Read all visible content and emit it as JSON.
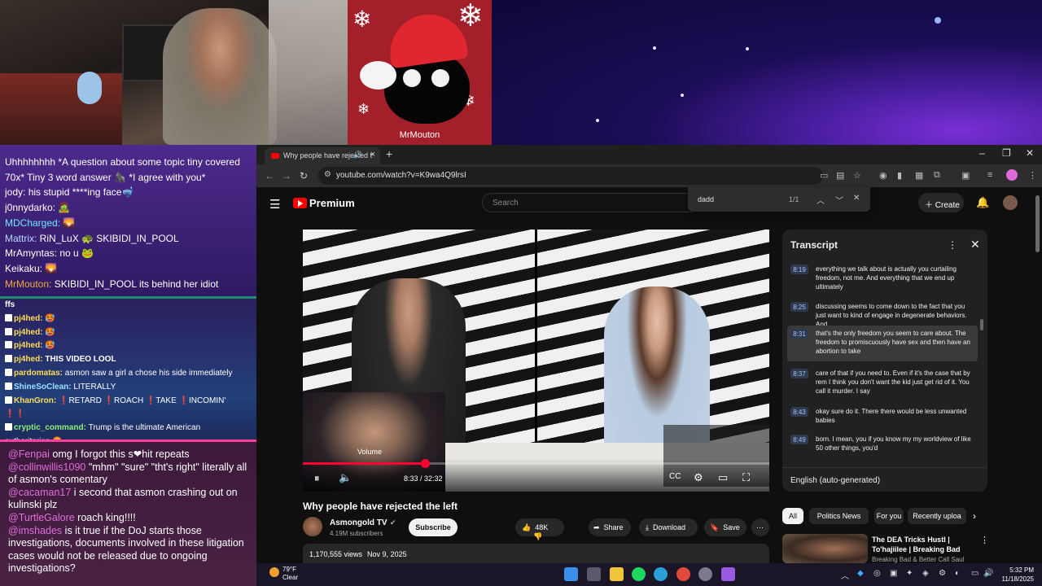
{
  "overlay": {
    "mascot_name": "MrMouton"
  },
  "chat_top": [
    {
      "user": "",
      "user_color": "#ffffff",
      "text": "Uhhhhhhhh *A question about some topic tiny covered"
    },
    {
      "user": "",
      "user_color": "#ffffff",
      "text": "70x* Tiny 3 word answer 🦍 *I agree with you*"
    },
    {
      "user": "jody:",
      "user_color": "#ffffff",
      "text": "his stupid ****ing face🤿"
    },
    {
      "user": "j0nnydarko:",
      "user_color": "#ffffff",
      "text": "🧟"
    },
    {
      "user": "MDCharged:",
      "user_color": "#6fe6ff",
      "text": "🌄"
    },
    {
      "user": "Mattrix:",
      "user_color": "#b9d8ff",
      "text": "RiN_LuX 🐢 SKIBIDI_IN_POOL"
    },
    {
      "user": "MrAmyntas:",
      "user_color": "#ffffff",
      "text": "no u 🐸"
    },
    {
      "user": "Keikaku:",
      "user_color": "#ffffff",
      "text": "🌄"
    },
    {
      "user": "MrMouton:",
      "user_color": "#f3a93a",
      "text": "SKIBIDI_IN_POOL its behind her idiot"
    }
  ],
  "chat_mid": [
    {
      "user": "ffs",
      "user_color": "#ffffff",
      "text": ""
    },
    {
      "user": "pj4hed:",
      "user_color": "#ffdd55",
      "text": "🥵"
    },
    {
      "user": "pj4hed:",
      "user_color": "#ffdd55",
      "text": "🥵"
    },
    {
      "user": "pj4hed:",
      "user_color": "#ffdd55",
      "text": "🥵"
    },
    {
      "user": "pj4hed:",
      "user_color": "#ffdd55",
      "text": "THIS VIDEO LOOL"
    },
    {
      "user": "pardomatas:",
      "user_color": "#ffdd55",
      "text": "asmon saw a girl a chose his side immediately"
    },
    {
      "user": "ShineSoClean:",
      "user_color": "#9ae0ff",
      "text": "LITERALLY"
    },
    {
      "user": "KhanGron:",
      "user_color": "#ffdd55",
      "text": "❗RETARD ❗ROACH ❗TAKE ❗INCOMIN'"
    },
    {
      "user": "",
      "user_color": "#ffffff",
      "text": "❗❗"
    },
    {
      "user": "cryptic_command:",
      "user_color": "#8af07a",
      "text": "Trump is the ultimate American"
    },
    {
      "user": "",
      "user_color": "#ffffff",
      "text": "authoritarian 😡"
    }
  ],
  "chat_bottom": [
    {
      "user": "@Fenpai",
      "text": "omg I forgot this s❤hit repeats"
    },
    {
      "user": "@collinwillis1090",
      "text": "\"mhm\" \"sure\" \"tht's right\" literally all of asmon's comentary"
    },
    {
      "user": "@cacaman17",
      "text": "i second that asmon crashing out on kulinski plz"
    },
    {
      "user": "@TurtleGalore",
      "text": "roach king!!!!"
    },
    {
      "user": "@imshades",
      "text": "is it true if the DoJ starts those investigations, documents involved in these litigation cases would not be released due to ongoing investigations?"
    }
  ],
  "browser": {
    "tab_title": "Why people have rejected t",
    "url": "youtube.com/watch?v=K9wa4Q9lrsI"
  },
  "youtube": {
    "brand": "Premium",
    "search_placeholder": "Search",
    "create_label": "Create",
    "find_query": "dadd",
    "find_count": "1/1"
  },
  "player": {
    "volume_label": "Volume",
    "time_display": "8:33 / 32:32",
    "progress_fraction": 0.262
  },
  "video": {
    "title": "Why people have rejected the left",
    "channel": "Asmongold TV",
    "subscribers": "4.19M subscribers",
    "subscribe_label": "Subscribe",
    "likes": "48K",
    "share_label": "Share",
    "download_label": "Download",
    "save_label": "Save",
    "views": "1,170,555 views",
    "date": "Nov 9, 2025"
  },
  "transcript": {
    "title": "Transcript",
    "language": "English (auto-generated)",
    "segments": [
      {
        "time": "8:19",
        "text": "everything we talk about is actually you curtailing freedom, not me. And everything that we end up ultimately"
      },
      {
        "time": "8:25",
        "text": "discussing seems to come down to the fact that you just want to kind of engage in degenerate behaviors. And"
      },
      {
        "time": "8:31",
        "text": "that's the only freedom you seem to care about. The freedom to promiscuously have sex and then have an abortion to take"
      },
      {
        "time": "8:37",
        "text": "care of that if you need to. Even if it's the case that by rem I think you don't want the kid just get rid of it. You call it murder. I say"
      },
      {
        "time": "8:43",
        "text": "okay sure do it. There there would be less unwanted babies"
      },
      {
        "time": "8:49",
        "text": "born. I mean, you if you know my my worldview of like 50 other things, you'd"
      }
    ]
  },
  "chips": [
    "All",
    "Politics News",
    "For you",
    "Recently uploa"
  ],
  "recommended": {
    "title": "The DEA Tricks Hustl | To'hajiilee | Breaking Bad",
    "channel": "Breaking Bad & Better Call Saul"
  },
  "taskbar": {
    "temperature": "79°F",
    "condition": "Clear",
    "time": "5:32 PM",
    "date": "11/18/2025"
  }
}
